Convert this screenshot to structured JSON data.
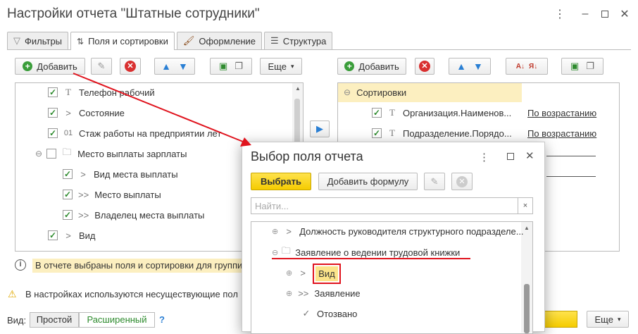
{
  "window": {
    "title": "Настройки отчета \"Штатные сотрудники\""
  },
  "tabs": [
    {
      "label": "Фильтры",
      "icon": "filter-icon"
    },
    {
      "label": "Поля и сортировки",
      "icon": "fields-sort-icon"
    },
    {
      "label": "Оформление",
      "icon": "brush-icon"
    },
    {
      "label": "Структура",
      "icon": "structure-icon"
    }
  ],
  "left_toolbar": {
    "add_label": "Добавить",
    "more_label": "Еще"
  },
  "left_tree": [
    {
      "label": "Телефон рабочий",
      "icon": "T",
      "checked": true
    },
    {
      "label": "Состояние",
      "icon": ">",
      "checked": true
    },
    {
      "label": "Стаж работы на предприятии лет",
      "icon": "01",
      "checked": true
    },
    {
      "label": "Место выплаты зарплаты",
      "icon": "folder",
      "checked": false
    },
    {
      "label": "Вид места выплаты",
      "icon": ">",
      "checked": true
    },
    {
      "label": "Место выплаты",
      "icon": ">>",
      "checked": true
    },
    {
      "label": "Владелец места выплаты",
      "icon": ">>",
      "checked": true
    },
    {
      "label": "Вид",
      "icon": ">",
      "checked": true
    }
  ],
  "left_info": "В отчете выбраны поля и сортировки для группир",
  "right_toolbar": {
    "add_label": "Добавить"
  },
  "sort_panel": {
    "header": "Сортировки",
    "rows": [
      {
        "field": "Организация.Наименов...",
        "order": "По возрастанию"
      },
      {
        "field": "Подразделение.Порядо...",
        "order": "По возрастанию"
      }
    ]
  },
  "warning": "В настройках используются несуществующие пол",
  "view_mode": {
    "label": "Вид:",
    "simple": "Простой",
    "extended": "Расширенный",
    "help": "?"
  },
  "bottom_right": {
    "more_label": "Еще"
  },
  "modal": {
    "title": "Выбор поля отчета",
    "select_label": "Выбрать",
    "formula_label": "Добавить формулу",
    "search_placeholder": "Найти...",
    "tree": [
      {
        "label": "Должность руководителя структурного подразделе..."
      },
      {
        "label": "Заявление о ведении трудовой книжки"
      },
      {
        "label": "Вид"
      },
      {
        "label": "Заявление"
      },
      {
        "label": "Отозвано"
      }
    ]
  },
  "colors": {
    "accent_yellow": "#f5d300",
    "highlight_row": "#fcefc0",
    "annotation_red": "#e0141e",
    "check_green": "#2e8b2e"
  }
}
